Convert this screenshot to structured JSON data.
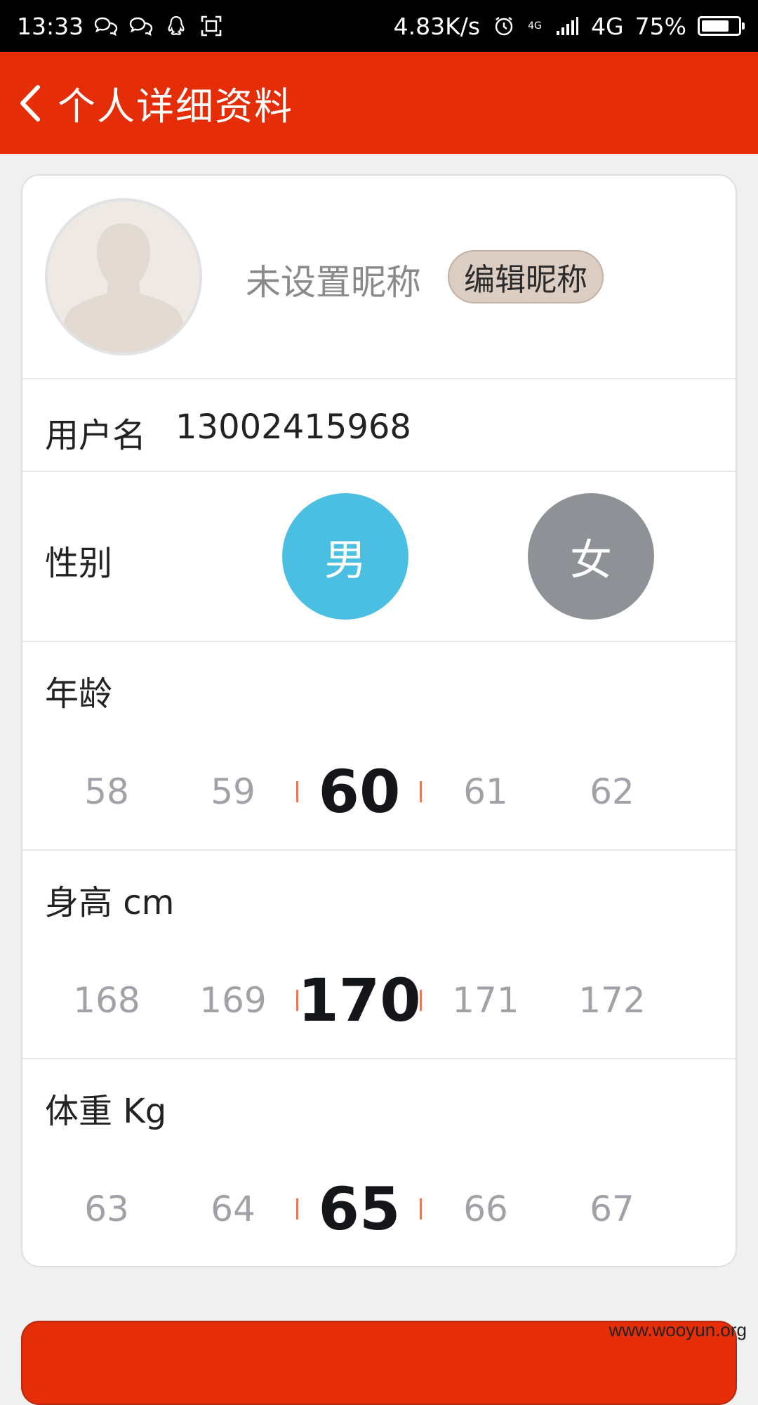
{
  "status_bar": {
    "time": "13:33",
    "left_icons": [
      "chat-bubbles-icon",
      "chat-bubbles-icon",
      "penguin-icon",
      "screenshot-frame-icon"
    ],
    "net_speed": "4.83K/s",
    "signal_small": "4G",
    "network": "4G",
    "battery": "75%",
    "battery_level": 0.75
  },
  "header": {
    "title": "个人详细资料",
    "back_icon": "chevron-left-icon",
    "background_color": "#e52e08"
  },
  "profile": {
    "avatar_icon": "default-avatar-silhouette",
    "nickname": "未设置昵称",
    "edit_nickname_label": "编辑昵称"
  },
  "username": {
    "label": "用户名",
    "value": "13002415968"
  },
  "gender": {
    "label": "性别",
    "male_label": "男",
    "female_label": "女",
    "selected": "男",
    "male_color": "#4bbfe2",
    "female_color": "#8e9297"
  },
  "age": {
    "label": "年龄",
    "options": [
      "58",
      "59",
      "60",
      "61",
      "62"
    ],
    "selected": "60"
  },
  "height": {
    "label": "身高 cm",
    "options": [
      "168",
      "169",
      "170",
      "171",
      "172"
    ],
    "selected": "170"
  },
  "weight": {
    "label": "体重 Kg",
    "options": [
      "63",
      "64",
      "65",
      "66",
      "67"
    ],
    "selected": "65"
  },
  "watermark": "www.wooyun.org"
}
